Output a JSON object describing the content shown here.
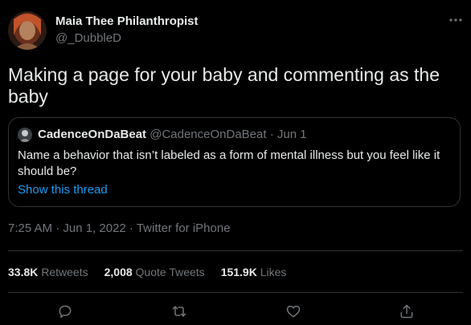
{
  "tweet": {
    "author_name": "Maia Thee Philanthropist",
    "author_handle": "@_DubbleD",
    "text": "Making a page for your baby and commenting as the baby",
    "timestamp": "7:25 AM · Jun 1, 2022 · Twitter for iPhone"
  },
  "quote": {
    "author_name": "CadenceOnDaBeat",
    "meta": "@CadenceOnDaBeat · Jun 1",
    "text": "Name a behavior that isn’t labeled as a form of mental illness but you feel like it should be?",
    "show_thread_label": "Show this thread"
  },
  "stats": {
    "retweets_count": "33.8K",
    "retweets_label": "Retweets",
    "quotes_count": "2,008",
    "quotes_label": "Quote Tweets",
    "likes_count": "151.9K",
    "likes_label": "Likes"
  },
  "actions": [
    "reply-icon",
    "retweet-icon",
    "like-icon",
    "share-icon"
  ],
  "colors": {
    "background": "#000000",
    "text_primary": "#e7e9ea",
    "text_secondary": "#71767b",
    "link": "#1d9bf0",
    "border": "#2f3336"
  }
}
